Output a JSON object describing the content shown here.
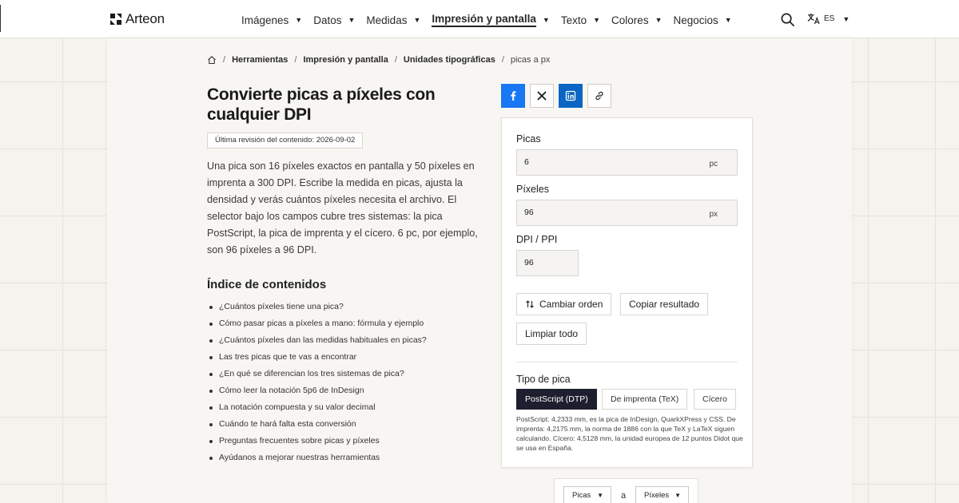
{
  "header": {
    "brand": "Arteon",
    "nav": [
      {
        "label": "Imágenes",
        "active": false
      },
      {
        "label": "Datos",
        "active": false
      },
      {
        "label": "Medidas",
        "active": false
      },
      {
        "label": "Impresión y pantalla",
        "active": true
      },
      {
        "label": "Texto",
        "active": false
      },
      {
        "label": "Colores",
        "active": false
      },
      {
        "label": "Negocios",
        "active": false
      }
    ],
    "caret": "▼",
    "lang": "ES"
  },
  "breadcrumb": {
    "items": [
      "Herramientas",
      "Impresión y pantalla",
      "Unidades tipográficas"
    ],
    "current": "picas a px",
    "sep": "/"
  },
  "page": {
    "title": "Convierte picas a píxeles con cualquier DPI",
    "revision": "Última revisión del contenido: 2026-09-02",
    "intro": "Una pica son 16 píxeles exactos en pantalla y 50 píxeles en imprenta a 300 DPI. Escribe la medida en picas, ajusta la densidad y verás cuántos píxeles necesita el archivo. El selector bajo los campos cubre tres sistemas: la pica PostScript, la pica de imprenta y el cícero. 6 pc, por ejemplo, son 96 píxeles a 96 DPI."
  },
  "toc": {
    "title": "Índice de contenidos",
    "items": [
      "¿Cuántos píxeles tiene una pica?",
      "Cómo pasar picas a píxeles a mano: fórmula y ejemplo",
      "¿Cuántos píxeles dan las medidas habituales en picas?",
      "Las tres picas que te vas a encontrar",
      "¿En qué se diferencian los tres sistemas de pica?",
      "Cómo leer la notación 5p6 de InDesign",
      "La notación compuesta y su valor decimal",
      "Cuándo te hará falta esta conversión",
      "Preguntas frecuentes sobre picas y píxeles",
      "Ayúdanos a mejorar nuestras herramientas"
    ]
  },
  "converter": {
    "picas_label": "Picas",
    "picas_value": "6",
    "picas_unit": "pc",
    "pixels_label": "Píxeles",
    "pixels_value": "96",
    "pixels_unit": "px",
    "dpi_label": "DPI / PPI",
    "dpi_value": "96",
    "swap_label": "Cambiar orden",
    "copy_label": "Copiar resultado",
    "clear_label": "Limpiar todo",
    "type_label": "Tipo de pica",
    "types": [
      "PostScript (DTP)",
      "De imprenta (TeX)",
      "Cícero"
    ],
    "active_type": 0,
    "note": "PostScript: 4,2333 mm, es la pica de InDesign, QuarkXPress y CSS. De imprenta: 4,2175 mm, la norma de 1886 con la que TeX y LaTeX siguen calculando. Cícero: 4,5128 mm, la unidad europea de 12 puntos Didot que se usa en España."
  },
  "bottom_selector": {
    "from": "Picas",
    "to": "Píxeles",
    "separator": "a"
  },
  "colors": {
    "facebook": "#1877f2",
    "linkedin": "#0a66c2",
    "active_segment": "#1d1f2e"
  }
}
